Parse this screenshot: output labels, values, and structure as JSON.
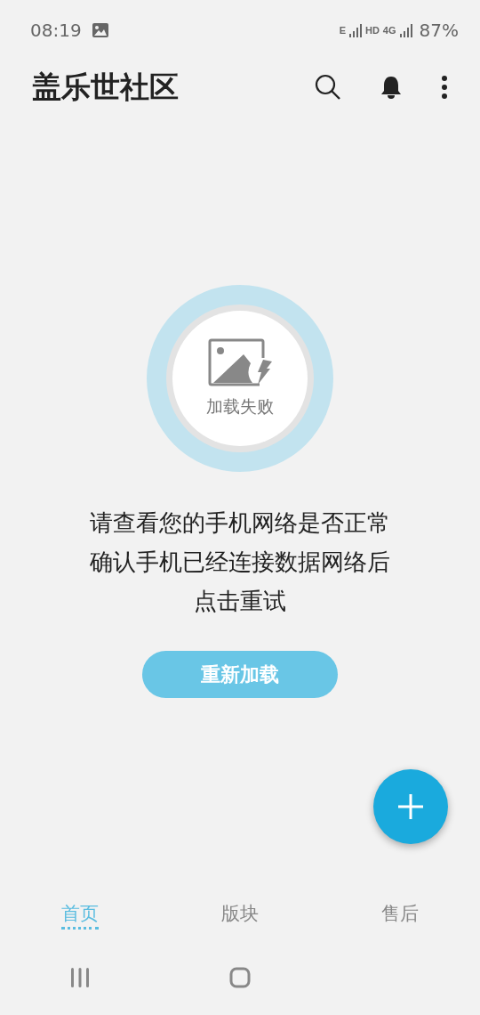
{
  "status_bar": {
    "time": "08:19",
    "network_labels": [
      "E",
      "HD",
      "4G"
    ],
    "battery": "87%"
  },
  "app_bar": {
    "title": "盖乐世社区"
  },
  "error": {
    "caption": "加载失败",
    "message_lines": [
      "请查看您的手机网络是否正常",
      "确认手机已经连接数据网络后",
      "点击重试"
    ],
    "button": "重新加载"
  },
  "tabs": [
    {
      "label": "首页",
      "selected": true
    },
    {
      "label": "版块",
      "selected": false
    },
    {
      "label": "售后",
      "selected": false
    }
  ]
}
